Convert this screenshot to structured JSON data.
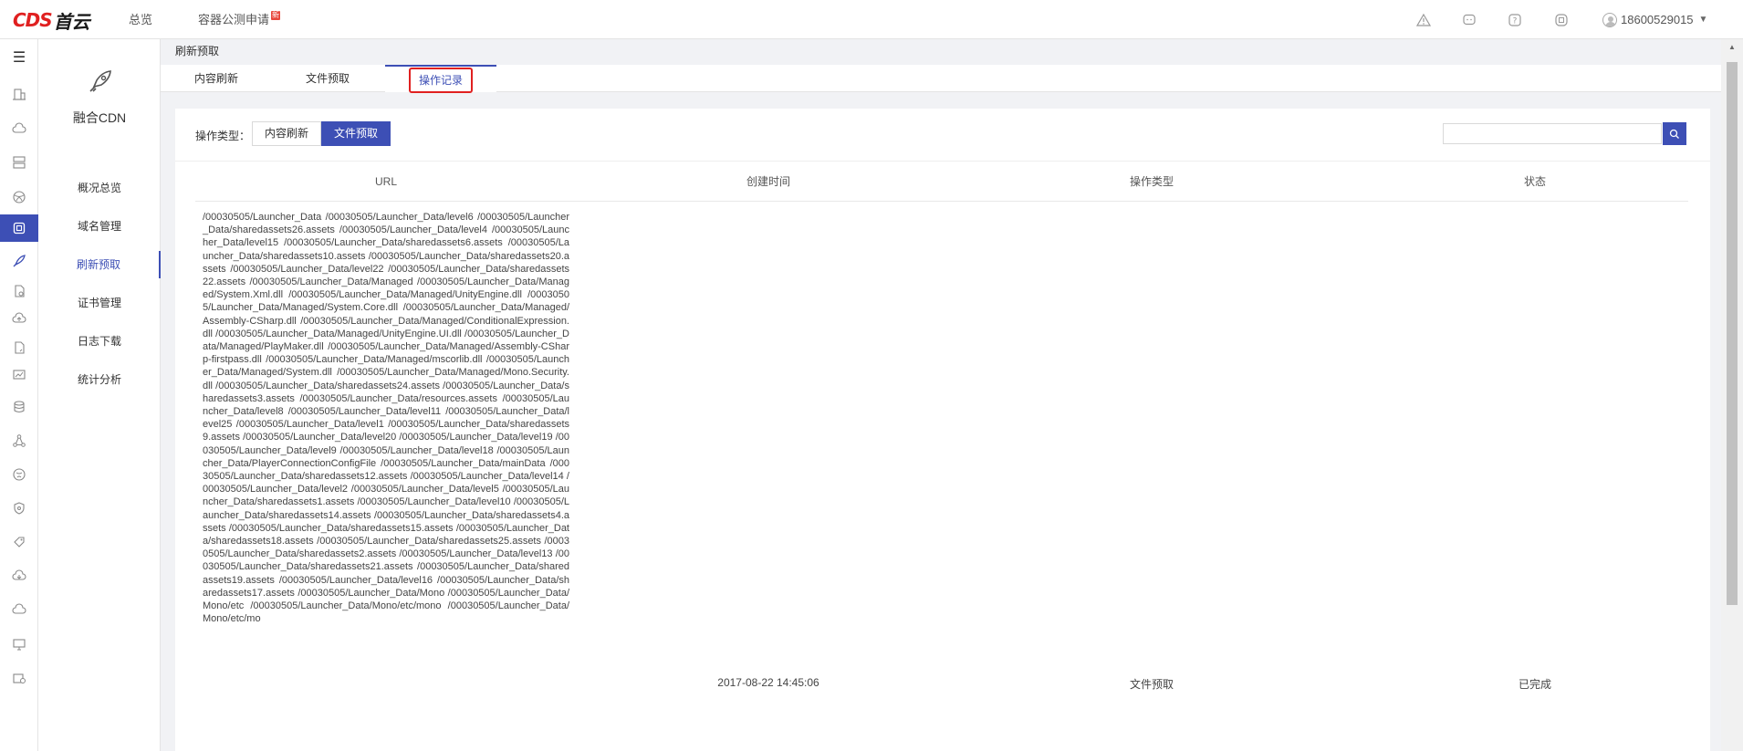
{
  "header": {
    "logo_latin": "CDS",
    "logo_cn": "首云",
    "nav": [
      {
        "label": "总览"
      },
      {
        "label": "容器公测申请",
        "badge": "新"
      }
    ],
    "icons": [
      "warning-icon",
      "chat-icon",
      "help-icon",
      "language-icon"
    ],
    "user": "18600529015"
  },
  "rail": {
    "icons": [
      "menu-icon",
      "building-icon",
      "cloud-icon",
      "server-icon",
      "network-icon",
      "cdn-icon",
      "rocket-icon",
      "doc-icon",
      "cloud-upload-icon",
      "file-icon",
      "monitor-icon",
      "database-icon",
      "topology-icon",
      "globe-icon",
      "shield-icon",
      "tag-icon",
      "cloud-download-icon",
      "cloud-icon",
      "display-icon",
      "settings-icon"
    ]
  },
  "submenu": {
    "product": "融合CDN",
    "items": [
      {
        "label": "概况总览"
      },
      {
        "label": "域名管理"
      },
      {
        "label": "刷新预取",
        "active": true
      },
      {
        "label": "证书管理"
      },
      {
        "label": "日志下载"
      },
      {
        "label": "统计分析"
      }
    ]
  },
  "main": {
    "breadcrumb": "刷新预取",
    "tabs": [
      {
        "label": "内容刷新"
      },
      {
        "label": "文件预取"
      },
      {
        "label": "操作记录",
        "active": true
      }
    ],
    "filter": {
      "label": "操作类型：",
      "options": [
        {
          "label": "内容刷新"
        },
        {
          "label": "文件预取",
          "selected": true
        }
      ],
      "search_value": ""
    },
    "table": {
      "columns": [
        "URL",
        "创建时间",
        "操作类型",
        "状态"
      ],
      "rows": [
        {
          "url": "/00030505/Launcher_Data /00030505/Launcher_Data/level6 /00030505/Launcher_Data/sharedassets26.assets /00030505/Launcher_Data/level4 /00030505/Launcher_Data/level15 /00030505/Launcher_Data/sharedassets6.assets /00030505/Launcher_Data/sharedassets10.assets /00030505/Launcher_Data/sharedassets20.assets /00030505/Launcher_Data/level22 /00030505/Launcher_Data/sharedassets22.assets /00030505/Launcher_Data/Managed /00030505/Launcher_Data/Managed/System.Xml.dll /00030505/Launcher_Data/Managed/UnityEngine.dll /00030505/Launcher_Data/Managed/System.Core.dll /00030505/Launcher_Data/Managed/Assembly-CSharp.dll /00030505/Launcher_Data/Managed/ConditionalExpression.dll /00030505/Launcher_Data/Managed/UnityEngine.UI.dll /00030505/Launcher_Data/Managed/PlayMaker.dll /00030505/Launcher_Data/Managed/Assembly-CSharp-firstpass.dll /00030505/Launcher_Data/Managed/mscorlib.dll /00030505/Launcher_Data/Managed/System.dll /00030505/Launcher_Data/Managed/Mono.Security.dll /00030505/Launcher_Data/sharedassets24.assets /00030505/Launcher_Data/sharedassets3.assets /00030505/Launcher_Data/resources.assets /00030505/Launcher_Data/level8 /00030505/Launcher_Data/level11 /00030505/Launcher_Data/level25 /00030505/Launcher_Data/level1 /00030505/Launcher_Data/sharedassets9.assets /00030505/Launcher_Data/level20 /00030505/Launcher_Data/level19 /00030505/Launcher_Data/level9 /00030505/Launcher_Data/level18 /00030505/Launcher_Data/PlayerConnectionConfigFile /00030505/Launcher_Data/mainData /00030505/Launcher_Data/sharedassets12.assets /00030505/Launcher_Data/level14 /00030505/Launcher_Data/level2 /00030505/Launcher_Data/level5 /00030505/Launcher_Data/sharedassets1.assets /00030505/Launcher_Data/level10 /00030505/Launcher_Data/sharedassets14.assets /00030505/Launcher_Data/sharedassets4.assets /00030505/Launcher_Data/sharedassets15.assets /00030505/Launcher_Data/sharedassets18.assets /00030505/Launcher_Data/sharedassets25.assets /00030505/Launcher_Data/sharedassets2.assets /00030505/Launcher_Data/level13 /00030505/Launcher_Data/sharedassets21.assets /00030505/Launcher_Data/sharedassets19.assets /00030505/Launcher_Data/level16 /00030505/Launcher_Data/sharedassets17.assets /00030505/Launcher_Data/Mono /00030505/Launcher_Data/Mono/etc /00030505/Launcher_Data/Mono/etc/mono /00030505/Launcher_Data/Mono/etc/mo",
          "created": "2017-08-22 14:45:06",
          "type": "文件预取",
          "status": "已完成"
        }
      ]
    }
  },
  "colors": {
    "accent": "#3d4fb5",
    "highlight": "#e02020",
    "badge": "#e8473c"
  }
}
